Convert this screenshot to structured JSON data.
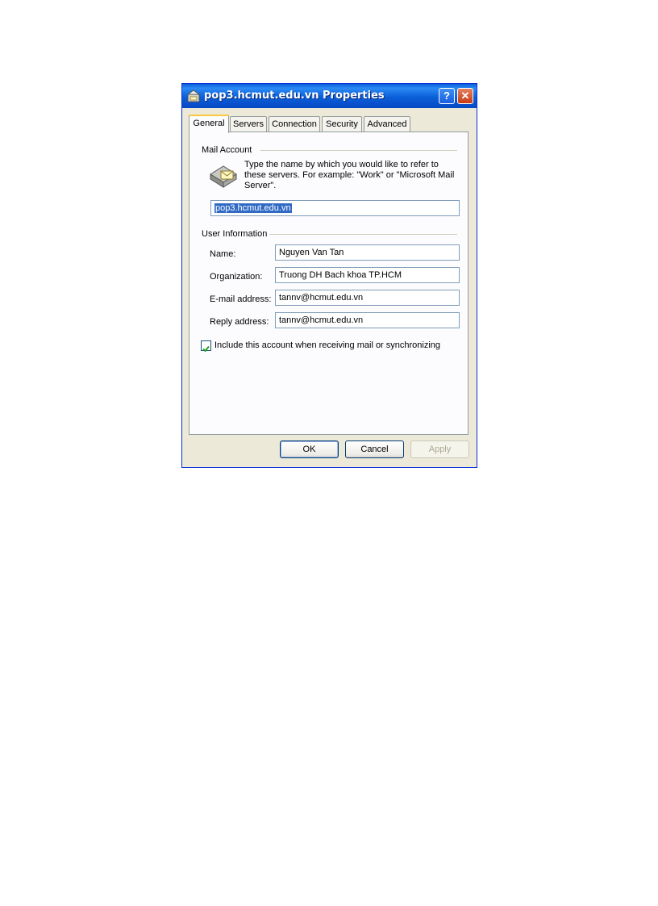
{
  "window": {
    "title": "pop3.hcmut.edu.vn Properties",
    "help_label": "?",
    "close_label": "✕"
  },
  "tabs": [
    {
      "label": "General",
      "active": true
    },
    {
      "label": "Servers"
    },
    {
      "label": "Connection"
    },
    {
      "label": "Security"
    },
    {
      "label": "Advanced"
    }
  ],
  "mail_account": {
    "heading": "Mail Account",
    "description": "Type the name by which you would like to refer to these servers.  For example: \"Work\" or \"Microsoft Mail Server\".",
    "account_name": "pop3.hcmut.edu.vn"
  },
  "user_information": {
    "heading": "User Information",
    "name_label": "Name:",
    "name_value": "Nguyen Van Tan",
    "organization_label": "Organization:",
    "organization_value": "Truong DH Bach khoa TP.HCM",
    "email_label": "E-mail address:",
    "email_value": "tannv@hcmut.edu.vn",
    "reply_label": "Reply address:",
    "reply_value": "tannv@hcmut.edu.vn"
  },
  "include_account": {
    "label": "Include this account when receiving mail or synchronizing",
    "checked": true
  },
  "buttons": {
    "ok": "OK",
    "cancel": "Cancel",
    "apply": "Apply"
  },
  "colors": {
    "titlebar": "#0a5fd9",
    "dialog_bg": "#ece9d8",
    "selection": "#316ac5",
    "active_tab_accent": "#ffc83c"
  }
}
